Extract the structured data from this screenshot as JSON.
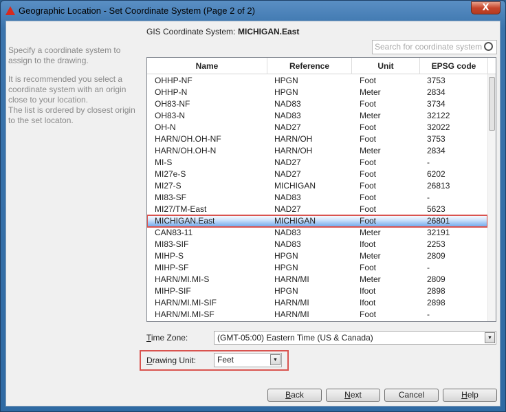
{
  "window": {
    "title": "Geographic Location - Set Coordinate System (Page 2 of 2)",
    "close_label": "X"
  },
  "instructions": [
    "Specify a coordinate system to assign to the drawing.",
    "It is recommended you select a coordinate system with an origin close to your location.",
    "The list is ordered by closest origin to the set locaton."
  ],
  "gis": {
    "label": "GIS Coordinate System:",
    "value": "MICHIGAN.East"
  },
  "search": {
    "placeholder": "Search for coordinate system"
  },
  "table": {
    "columns": [
      "Name",
      "Reference",
      "Unit",
      "EPSG code"
    ],
    "selected_index": 12,
    "rows": [
      [
        "OHHP-NF",
        "HPGN",
        "Foot",
        "3753"
      ],
      [
        "OHHP-N",
        "HPGN",
        "Meter",
        "2834"
      ],
      [
        "OH83-NF",
        "NAD83",
        "Foot",
        "3734"
      ],
      [
        "OH83-N",
        "NAD83",
        "Meter",
        "32122"
      ],
      [
        "OH-N",
        "NAD27",
        "Foot",
        "32022"
      ],
      [
        "HARN/OH.OH-NF",
        "HARN/OH",
        "Foot",
        "3753"
      ],
      [
        "HARN/OH.OH-N",
        "HARN/OH",
        "Meter",
        "2834"
      ],
      [
        "MI-S",
        "NAD27",
        "Foot",
        "-"
      ],
      [
        "MI27e-S",
        "NAD27",
        "Foot",
        "6202"
      ],
      [
        "MI27-S",
        "MICHIGAN",
        "Foot",
        "26813"
      ],
      [
        "MI83-SF",
        "NAD83",
        "Foot",
        "-"
      ],
      [
        "MI27/TM-East",
        "NAD27",
        "Foot",
        "5623"
      ],
      [
        "MICHIGAN.East",
        "MICHIGAN",
        "Foot",
        "26801"
      ],
      [
        "CAN83-11",
        "NAD83",
        "Meter",
        "32191"
      ],
      [
        "MI83-SIF",
        "NAD83",
        "Ifoot",
        "2253"
      ],
      [
        "MIHP-S",
        "HPGN",
        "Meter",
        "2809"
      ],
      [
        "MIHP-SF",
        "HPGN",
        "Foot",
        "-"
      ],
      [
        "HARN/MI.MI-S",
        "HARN/MI",
        "Meter",
        "2809"
      ],
      [
        "MIHP-SIF",
        "HPGN",
        "Ifoot",
        "2898"
      ],
      [
        "HARN/MI.MI-SIF",
        "HARN/MI",
        "Ifoot",
        "2898"
      ],
      [
        "HARN/MI.MI-SF",
        "HARN/MI",
        "Foot",
        "-"
      ]
    ]
  },
  "time_zone": {
    "label_u": "T",
    "label_rest": "ime Zone:",
    "value": "(GMT-05:00) Eastern Time (US & Canada)"
  },
  "drawing_unit": {
    "label_u": "D",
    "label_rest": "rawing Unit:",
    "value": "Feet"
  },
  "buttons": {
    "back": {
      "u": "B",
      "rest": "ack"
    },
    "next": {
      "u": "N",
      "rest": "ext"
    },
    "cancel": {
      "label": "Cancel"
    },
    "help": {
      "u": "H",
      "rest": "elp"
    }
  },
  "colors": {
    "highlight_outline": "#d9534f",
    "title_bar": "#3b74ac"
  }
}
